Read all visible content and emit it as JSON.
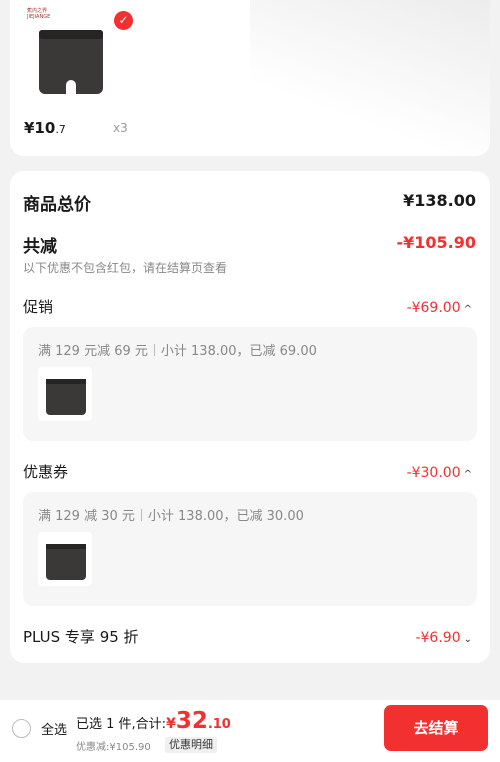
{
  "colors": {
    "accent": "#f23030",
    "background": "#f2f2f2",
    "card": "#ffffff"
  },
  "product": {
    "brand_mark": "蕉内之界\nJIEJIANGE",
    "price_int": "¥10",
    "price_dec": ".7",
    "qty": "x3",
    "selected": true
  },
  "summary": {
    "total_label": "商品总价",
    "total_value": "¥138.00",
    "reduce_label": "共减",
    "reduce_value": "-¥105.90",
    "reduce_note": "以下优惠不包含红包，请在结算页查看"
  },
  "promo": {
    "label": "促销",
    "amount": "-¥69.00",
    "caret": "^",
    "rule": "满 129 元减 69 元",
    "detail": "小计 138.00，已减 69.00"
  },
  "coupon": {
    "label": "优惠券",
    "amount": "-¥30.00",
    "caret": "^",
    "rule": "满 129 减 30 元",
    "detail": "小计 138.00，已减 30.00"
  },
  "plus": {
    "label": "PLUS 专享 95 折",
    "amount": "-¥6.90",
    "caret": "⌄"
  },
  "bottom_bar": {
    "select_all": "全选",
    "selected_count": "已选 1 件,合计:",
    "total_symbol": "¥",
    "total_int": "32",
    "total_dec": ".10",
    "discount_text": "优惠减:¥105.90",
    "detail_link": "优惠明细",
    "checkout": "去结算"
  }
}
